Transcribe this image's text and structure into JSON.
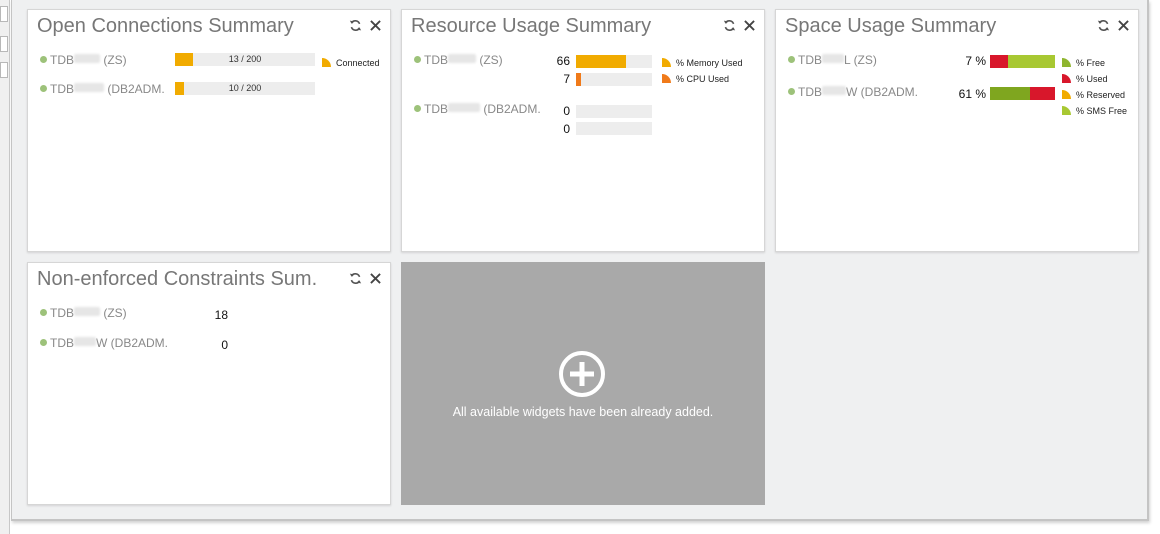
{
  "colors": {
    "accent_amber": "#f1ab00",
    "cpu_orange": "#f07a1a",
    "used_red": "#d8172b",
    "free_green": "#a8c832",
    "sms_green": "#8fb52f",
    "status_dot": "#9dc27a",
    "placeholder_gray": "#a9a9a9"
  },
  "icons": {
    "refresh": "refresh-icon",
    "close": "close-icon",
    "add": "add-circle-icon"
  },
  "widgets": {
    "connections": {
      "title": "Open Connections Summary",
      "rows": [
        {
          "name_a": "TDB",
          "name_b": " (ZS)",
          "value_text": "13 / 200",
          "fraction": 0.065
        },
        {
          "name_a": "TDB",
          "name_b": " (DB2ADM.",
          "value_text": "10 / 200",
          "fraction": 0.05
        }
      ],
      "legend": [
        {
          "label": "Connected",
          "color": "#f1ab00"
        }
      ]
    },
    "resource": {
      "title": "Resource Usage Summary",
      "rows": [
        {
          "name_a": "TDB",
          "name_b": " (ZS)",
          "memory": 66,
          "cpu": 7
        },
        {
          "name_a": "TDB",
          "name_b": " (DB2ADM.",
          "memory": 0,
          "cpu": 0
        }
      ],
      "legend": [
        {
          "label": "% Memory Used",
          "color": "#f1ab00"
        },
        {
          "label": "% CPU Used",
          "color": "#f07a1a"
        }
      ]
    },
    "space": {
      "title": "Space Usage Summary",
      "rows": [
        {
          "name_a": "TDB",
          "name_b": "L (ZS)",
          "percent_text": "7 %",
          "used": 0.28,
          "reserved": 0.0,
          "free": 0.72,
          "sms_free": 0.0
        },
        {
          "name_a": "TDB",
          "name_b": "W (DB2ADM.",
          "percent_text": "61 %",
          "used": 0.0,
          "reserved": 0.0,
          "free": 0.61,
          "sms_free": 0.0,
          "used_tail": 0.39
        }
      ],
      "legend": [
        {
          "label": "% Free",
          "color": "#8fb52f"
        },
        {
          "label": "% Used",
          "color": "#d8172b"
        },
        {
          "label": "% Reserved",
          "color": "#f1ab00"
        },
        {
          "label": "% SMS Free",
          "color": "#a8c832"
        }
      ]
    },
    "constraints": {
      "title": "Non-enforced Constraints Sum.",
      "rows": [
        {
          "name_a": "TDB",
          "name_b": " (ZS)",
          "value": "18"
        },
        {
          "name_a": "TDB",
          "name_b": "W (DB2ADM.",
          "value": "0"
        }
      ]
    }
  },
  "placeholder": {
    "message": "All available widgets have been already added."
  }
}
